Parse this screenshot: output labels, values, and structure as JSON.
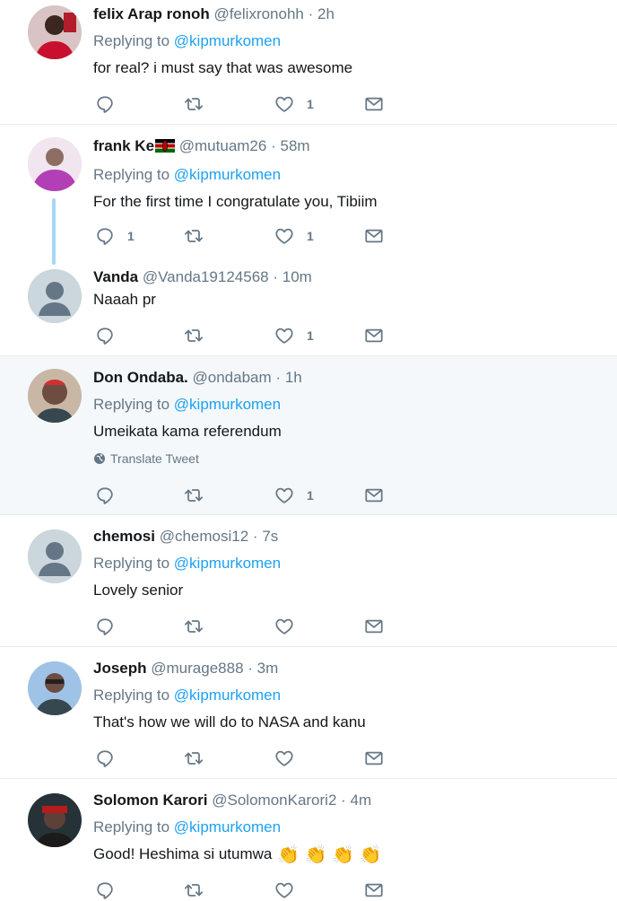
{
  "tweets": [
    {
      "name": "felix Arap ronoh",
      "handle": "@felixronohh",
      "time": "2h",
      "replying_label": "Replying to",
      "replying_to": "@kipmurkomen",
      "text": "for real? i must say that was awesome",
      "reply_count": "",
      "like_count": "1"
    },
    {
      "name": "frank Ke",
      "handle": "@mutuam26",
      "time": "58m",
      "replying_label": "Replying to",
      "replying_to": "@kipmurkomen",
      "text": "For the first time I congratulate you, Tibiim",
      "reply_count": "1",
      "like_count": "1"
    },
    {
      "name": "Vanda",
      "handle": "@Vanda19124568",
      "time": "10m",
      "text": "Naaah pr",
      "reply_count": "",
      "like_count": "1"
    },
    {
      "name": "Don Ondaba.",
      "handle": "@ondabam",
      "time": "1h",
      "replying_label": "Replying to",
      "replying_to": "@kipmurkomen",
      "text": "Umeikata kama referendum",
      "translate_label": "Translate Tweet",
      "reply_count": "",
      "like_count": "1"
    },
    {
      "name": "chemosi",
      "handle": "@chemosi12",
      "time": "7s",
      "replying_label": "Replying to",
      "replying_to": "@kipmurkomen",
      "text": "Lovely senior",
      "reply_count": "",
      "like_count": ""
    },
    {
      "name": "Joseph",
      "handle": "@murage888",
      "time": "3m",
      "replying_label": "Replying to",
      "replying_to": "@kipmurkomen",
      "text": "That's how we will do to NASA and kanu",
      "reply_count": "",
      "like_count": ""
    },
    {
      "name": "Solomon Karori",
      "handle": "@SolomonKarori2",
      "time": "4m",
      "replying_label": "Replying to",
      "replying_to": "@kipmurkomen",
      "text": "Good! Heshima si utumwa",
      "emoji": "👏 👏 👏 👏",
      "reply_count": "",
      "like_count": ""
    }
  ],
  "separator": "·",
  "colors": {
    "link": "#1da1f2",
    "secondary": "#657786",
    "thread_line": "#a6d8f6",
    "highlight_bg": "#f5f8fa"
  },
  "icons": [
    "reply-icon",
    "retweet-icon",
    "like-icon",
    "direct-message-icon",
    "globe-icon",
    "kenya-flag-icon"
  ]
}
